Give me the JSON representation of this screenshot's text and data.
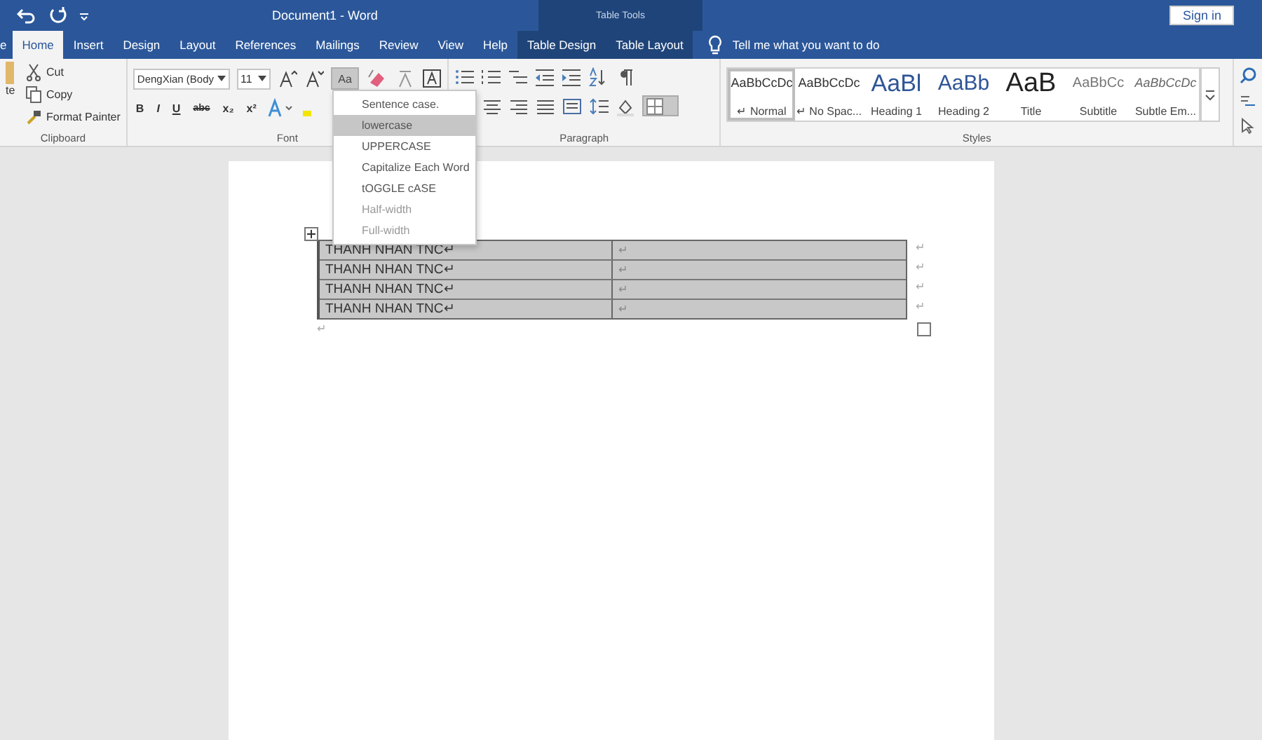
{
  "title_bar": {
    "title": "Document1  -  Word",
    "context_label": "Table Tools",
    "sign_in": "Sign in"
  },
  "tabs": [
    {
      "label": "e",
      "selected": false,
      "kind": "normal"
    },
    {
      "label": "Home",
      "selected": true,
      "kind": "normal"
    },
    {
      "label": "Insert",
      "selected": false,
      "kind": "normal"
    },
    {
      "label": "Design",
      "selected": false,
      "kind": "normal"
    },
    {
      "label": "Layout",
      "selected": false,
      "kind": "normal"
    },
    {
      "label": "References",
      "selected": false,
      "kind": "normal"
    },
    {
      "label": "Mailings",
      "selected": false,
      "kind": "normal"
    },
    {
      "label": "Review",
      "selected": false,
      "kind": "normal"
    },
    {
      "label": "View",
      "selected": false,
      "kind": "normal"
    },
    {
      "label": "Help",
      "selected": false,
      "kind": "normal"
    },
    {
      "label": "Table Design",
      "selected": false,
      "kind": "contextual"
    },
    {
      "label": "Table Layout",
      "selected": false,
      "kind": "contextual"
    }
  ],
  "tell_me": "Tell me what you want to do",
  "clipboard": {
    "paste_label": "te",
    "items": [
      "Cut",
      "Copy",
      "Format Painter"
    ],
    "label": "Clipboard"
  },
  "font": {
    "name": "DengXian (Body",
    "size": "11",
    "case_button": "Aa",
    "formats": [
      "B",
      "I",
      "U",
      "abc",
      "x₂",
      "x²"
    ],
    "label": "Font"
  },
  "paragraph": {
    "label": "Paragraph"
  },
  "styles": {
    "label": "Styles",
    "items": [
      {
        "preview": "AaBbCcDc",
        "name": "↵ Normal",
        "kind": "plain",
        "selected": true
      },
      {
        "preview": "AaBbCcDc",
        "name": "↵ No Spac...",
        "kind": "plain",
        "selected": false
      },
      {
        "preview": "AaBl",
        "name": "Heading 1",
        "kind": "heading",
        "selected": false
      },
      {
        "preview": "AaBb",
        "name": "Heading 2",
        "kind": "heading2",
        "selected": false
      },
      {
        "preview": "AaB",
        "name": "Title",
        "kind": "title",
        "selected": false
      },
      {
        "preview": "AaBbCc",
        "name": "Subtitle",
        "kind": "subtitle",
        "selected": false
      },
      {
        "preview": "AaBbCcDc",
        "name": "Subtle Em...",
        "kind": "emphasis",
        "selected": false
      }
    ]
  },
  "case_menu": [
    {
      "label": "Sentence case.",
      "selected": false,
      "disabled": false
    },
    {
      "label": "lowercase",
      "selected": true,
      "disabled": false
    },
    {
      "label": "UPPERCASE",
      "selected": false,
      "disabled": false
    },
    {
      "label": "Capitalize Each Word",
      "selected": false,
      "disabled": false
    },
    {
      "label": "tOGGLE cASE",
      "selected": false,
      "disabled": false
    },
    {
      "label": "Half-width",
      "selected": false,
      "disabled": true
    },
    {
      "label": "Full-width",
      "selected": false,
      "disabled": true
    }
  ],
  "table": {
    "rows": [
      [
        "THANH NHAN TNC↵",
        "↵"
      ],
      [
        "THANH NHAN TNC↵",
        "↵"
      ],
      [
        "THANH NHAN TNC↵",
        "↵"
      ],
      [
        "THANH NHAN TNC↵",
        "↵"
      ]
    ],
    "row_marks": [
      "↵",
      "↵",
      "↵",
      "↵"
    ]
  },
  "after_table_mark": "↵"
}
